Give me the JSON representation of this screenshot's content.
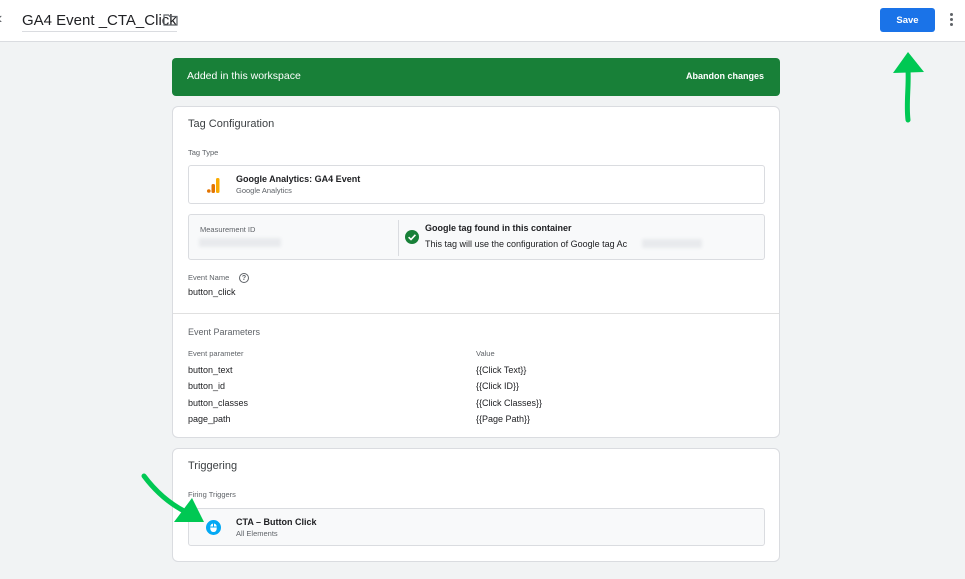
{
  "header": {
    "close_glyph": "‹",
    "tag_name": "GA4 Event _CTA_Click",
    "save_label": "Save"
  },
  "banner": {
    "text": "Added in this workspace",
    "abandon_label": "Abandon changes",
    "color": "#188038"
  },
  "tag_config": {
    "title": "Tag Configuration",
    "tag_type_label": "Tag Type",
    "tag_type_name": "Google Analytics: GA4 Event",
    "tag_type_sub": "Google Analytics",
    "measurement_label": "Measurement ID",
    "google_tag_title": "Google tag found in this container",
    "google_tag_desc": "This tag will use the configuration of Google tag Ac",
    "event_name_label": "Event Name",
    "help_glyph": "?",
    "event_name_value": "button_click",
    "params_title": "Event Parameters",
    "param_col_header": "Event parameter",
    "value_col_header": "Value",
    "params": [
      {
        "name": "button_text",
        "value": "{{Click Text}}"
      },
      {
        "name": "button_id",
        "value": "{{Click ID}}"
      },
      {
        "name": "button_classes",
        "value": "{{Click Classes}}"
      },
      {
        "name": "page_path",
        "value": "{{Page Path}}"
      }
    ]
  },
  "triggering": {
    "title": "Triggering",
    "firing_label": "Firing Triggers",
    "trigger_name": "CTA – Button Click",
    "trigger_sub": "All Elements"
  },
  "colors": {
    "accent": "#1a73e8",
    "success": "#188038",
    "annotation_arrow": "#00c853"
  },
  "icons": [
    "folder-icon",
    "more-vert-icon",
    "ga-bars-icon",
    "check-circle-icon",
    "help-icon",
    "click-trigger-icon",
    "annotation-arrow"
  ]
}
